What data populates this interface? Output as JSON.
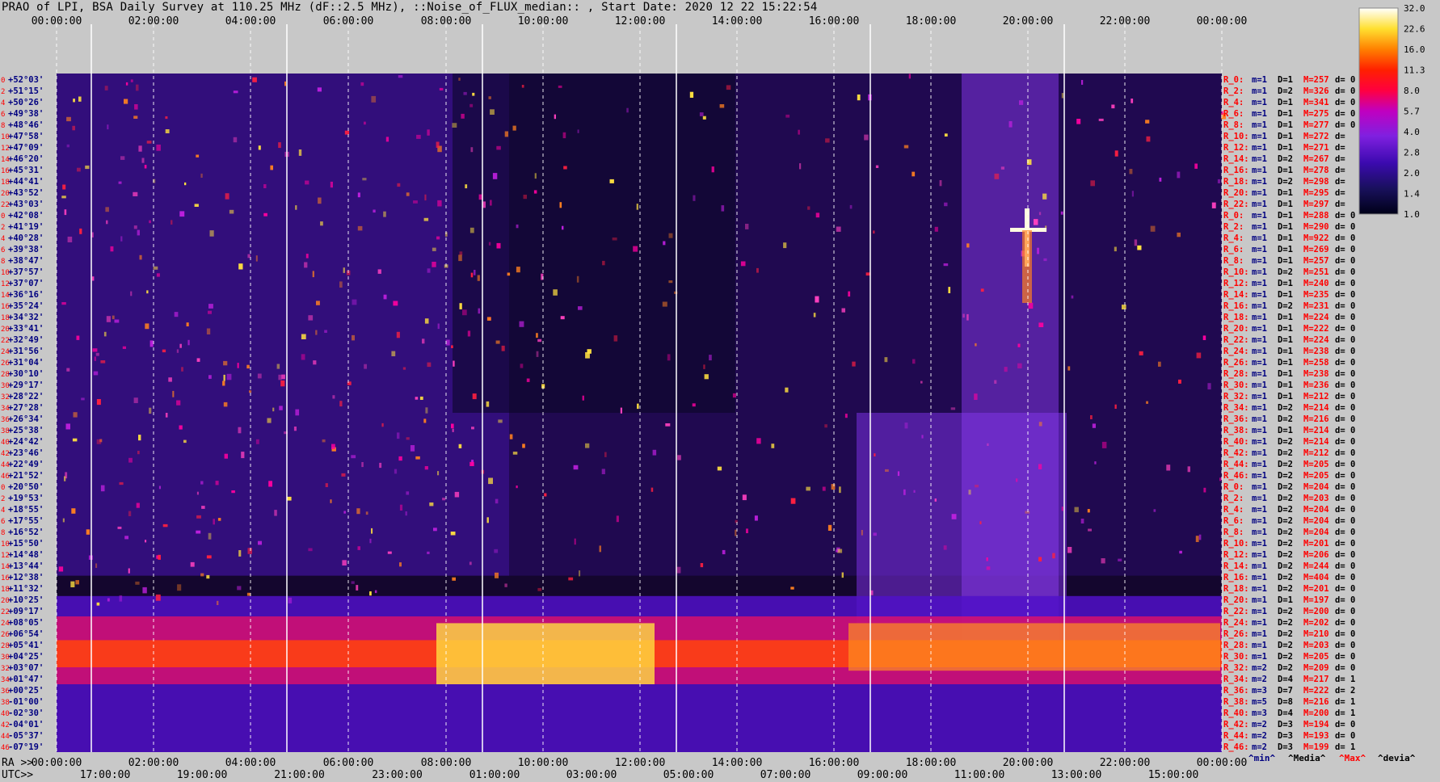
{
  "chart_data": {
    "type": "heatmap",
    "title": "PRAO of LPI, BSA Daily Survey at 110.25 MHz (dF::2.5 MHz), ::Noise_of_FLUX_median:: , Start Date: 2020 12 22 15:22:54",
    "top_axis_ticks": [
      "00:00:00",
      "02:00:00",
      "04:00:00",
      "06:00:00",
      "08:00:00",
      "10:00:00",
      "12:00:00",
      "14:00:00",
      "16:00:00",
      "18:00:00",
      "20:00:00",
      "22:00:00",
      "00:00:00"
    ],
    "ra_axis_label": "RA >>",
    "ra_axis_ticks": [
      "00:00:00",
      "02:00:00",
      "04:00:00",
      "06:00:00",
      "08:00:00",
      "10:00:00",
      "12:00:00",
      "14:00:00",
      "16:00:00",
      "18:00:00",
      "20:00:00",
      "22:00:00",
      "00:00:00"
    ],
    "utc_axis_label": "UTC>>",
    "utc_axis_ticks": [
      "17:00:00",
      "19:00:00",
      "21:00:00",
      "23:00:00",
      "01:00:00",
      "03:00:00",
      "05:00:00",
      "07:00:00",
      "09:00:00",
      "11:00:00",
      "13:00:00",
      "15:00:00"
    ],
    "declination_labels": [
      "+52°03'",
      "+51°15'",
      "+50°26'",
      "+49°38'",
      "+48°46'",
      "+47°58'",
      "+47°09'",
      "+46°20'",
      "+45°31'",
      "+44°41'",
      "+43°52'",
      "+43°03'",
      "+42°08'",
      "+41°19'",
      "+40°28'",
      "+39°38'",
      "+38°47'",
      "+37°57'",
      "+37°07'",
      "+36°16'",
      "+35°24'",
      "+34°32'",
      "+33°41'",
      "+32°49'",
      "+31°56'",
      "+31°04'",
      "+30°10'",
      "+29°17'",
      "+28°22'",
      "+27°28'",
      "+26°34'",
      "+25°38'",
      "+24°42'",
      "+23°46'",
      "+22°49'",
      "+21°52'",
      "+20°50'",
      "+19°53'",
      "+18°55'",
      "+17°55'",
      "+16°52'",
      "+15°50'",
      "+14°48'",
      "+13°44'",
      "+12°38'",
      "+11°32'",
      "+10°25'",
      "+09°17'",
      "+08°05'",
      "+06°54'",
      "+05°41'",
      "+04°25'",
      "+03°07'",
      "+01°47'",
      "+00°25'",
      "-01°00'",
      "-02°30'",
      "-04°01'",
      "-05°37'",
      "-07°19'"
    ],
    "row_index_labels": [
      "0",
      "2",
      "4",
      "6",
      "8",
      "10",
      "12",
      "14",
      "16",
      "18",
      "20",
      "22",
      "0",
      "2",
      "4",
      "6",
      "8",
      "10",
      "12",
      "14",
      "16",
      "18",
      "20",
      "22",
      "24",
      "26",
      "28",
      "30",
      "32",
      "34",
      "36",
      "38",
      "40",
      "42",
      "44",
      "46",
      "0",
      "2",
      "4",
      "6",
      "8",
      "10",
      "12",
      "14",
      "16",
      "18",
      "20",
      "22",
      "24",
      "26",
      "28",
      "30",
      "32",
      "34",
      "36",
      "38",
      "40",
      "42",
      "44",
      "46"
    ],
    "receiver_stats": [
      {
        "r": "R_0:",
        "m": "m=1",
        "d": "D=1",
        "max": "M=257",
        "dev": "d= 0"
      },
      {
        "r": "R_2:",
        "m": "m=1",
        "d": "D=2",
        "max": "M=326",
        "dev": "d= 0"
      },
      {
        "r": "R_4:",
        "m": "m=1",
        "d": "D=1",
        "max": "M=341",
        "dev": "d= 0"
      },
      {
        "r": "R_6:",
        "m": "m=1",
        "d": "D=1",
        "max": "M=275",
        "dev": "d= 0"
      },
      {
        "r": "R_8:",
        "m": "m=1",
        "d": "D=1",
        "max": "M=277",
        "dev": "d= 0"
      },
      {
        "r": "R_10:",
        "m": "m=1",
        "d": "D=1",
        "max": "M=272",
        "dev": "d="
      },
      {
        "r": "R_12:",
        "m": "m=1",
        "d": "D=1",
        "max": "M=271",
        "dev": "d="
      },
      {
        "r": "R_14:",
        "m": "m=1",
        "d": "D=2",
        "max": "M=267",
        "dev": "d="
      },
      {
        "r": "R_16:",
        "m": "m=1",
        "d": "D=1",
        "max": "M=278",
        "dev": "d="
      },
      {
        "r": "R_18:",
        "m": "m=1",
        "d": "D=2",
        "max": "M=298",
        "dev": "d="
      },
      {
        "r": "R_20:",
        "m": "m=1",
        "d": "D=1",
        "max": "M=295",
        "dev": "d="
      },
      {
        "r": "R_22:",
        "m": "m=1",
        "d": "D=1",
        "max": "M=297",
        "dev": "d="
      },
      {
        "r": "R_0:",
        "m": "m=1",
        "d": "D=1",
        "max": "M=288",
        "dev": "d= 0"
      },
      {
        "r": "R_2:",
        "m": "m=1",
        "d": "D=1",
        "max": "M=290",
        "dev": "d= 0"
      },
      {
        "r": "R_4:",
        "m": "m=1",
        "d": "D=1",
        "max": "M=922",
        "dev": "d= 0"
      },
      {
        "r": "R_6:",
        "m": "m=1",
        "d": "D=1",
        "max": "M=269",
        "dev": "d= 0"
      },
      {
        "r": "R_8:",
        "m": "m=1",
        "d": "D=1",
        "max": "M=257",
        "dev": "d= 0"
      },
      {
        "r": "R_10:",
        "m": "m=1",
        "d": "D=2",
        "max": "M=251",
        "dev": "d= 0"
      },
      {
        "r": "R_12:",
        "m": "m=1",
        "d": "D=1",
        "max": "M=240",
        "dev": "d= 0"
      },
      {
        "r": "R_14:",
        "m": "m=1",
        "d": "D=1",
        "max": "M=235",
        "dev": "d= 0"
      },
      {
        "r": "R_16:",
        "m": "m=1",
        "d": "D=2",
        "max": "M=231",
        "dev": "d= 0"
      },
      {
        "r": "R_18:",
        "m": "m=1",
        "d": "D=1",
        "max": "M=224",
        "dev": "d= 0"
      },
      {
        "r": "R_20:",
        "m": "m=1",
        "d": "D=1",
        "max": "M=222",
        "dev": "d= 0"
      },
      {
        "r": "R_22:",
        "m": "m=1",
        "d": "D=1",
        "max": "M=224",
        "dev": "d= 0"
      },
      {
        "r": "R_24:",
        "m": "m=1",
        "d": "D=1",
        "max": "M=238",
        "dev": "d= 0"
      },
      {
        "r": "R_26:",
        "m": "m=1",
        "d": "D=1",
        "max": "M=258",
        "dev": "d= 0"
      },
      {
        "r": "R_28:",
        "m": "m=1",
        "d": "D=1",
        "max": "M=238",
        "dev": "d= 0"
      },
      {
        "r": "R_30:",
        "m": "m=1",
        "d": "D=1",
        "max": "M=236",
        "dev": "d= 0"
      },
      {
        "r": "R_32:",
        "m": "m=1",
        "d": "D=1",
        "max": "M=212",
        "dev": "d= 0"
      },
      {
        "r": "R_34:",
        "m": "m=1",
        "d": "D=2",
        "max": "M=214",
        "dev": "d= 0"
      },
      {
        "r": "R_36:",
        "m": "m=1",
        "d": "D=2",
        "max": "M=216",
        "dev": "d= 0"
      },
      {
        "r": "R_38:",
        "m": "m=1",
        "d": "D=1",
        "max": "M=214",
        "dev": "d= 0"
      },
      {
        "r": "R_40:",
        "m": "m=1",
        "d": "D=2",
        "max": "M=214",
        "dev": "d= 0"
      },
      {
        "r": "R_42:",
        "m": "m=1",
        "d": "D=2",
        "max": "M=212",
        "dev": "d= 0"
      },
      {
        "r": "R_44:",
        "m": "m=1",
        "d": "D=2",
        "max": "M=205",
        "dev": "d= 0"
      },
      {
        "r": "R_46:",
        "m": "m=1",
        "d": "D=2",
        "max": "M=205",
        "dev": "d= 0"
      },
      {
        "r": "R_0:",
        "m": "m=1",
        "d": "D=2",
        "max": "M=204",
        "dev": "d= 0"
      },
      {
        "r": "R_2:",
        "m": "m=1",
        "d": "D=2",
        "max": "M=203",
        "dev": "d= 0"
      },
      {
        "r": "R_4:",
        "m": "m=1",
        "d": "D=2",
        "max": "M=204",
        "dev": "d= 0"
      },
      {
        "r": "R_6:",
        "m": "m=1",
        "d": "D=2",
        "max": "M=204",
        "dev": "d= 0"
      },
      {
        "r": "R_8:",
        "m": "m=1",
        "d": "D=2",
        "max": "M=204",
        "dev": "d= 0"
      },
      {
        "r": "R_10:",
        "m": "m=1",
        "d": "D=2",
        "max": "M=201",
        "dev": "d= 0"
      },
      {
        "r": "R_12:",
        "m": "m=1",
        "d": "D=2",
        "max": "M=206",
        "dev": "d= 0"
      },
      {
        "r": "R_14:",
        "m": "m=1",
        "d": "D=2",
        "max": "M=244",
        "dev": "d= 0"
      },
      {
        "r": "R_16:",
        "m": "m=1",
        "d": "D=2",
        "max": "M=404",
        "dev": "d= 0"
      },
      {
        "r": "R_18:",
        "m": "m=1",
        "d": "D=2",
        "max": "M=201",
        "dev": "d= 0"
      },
      {
        "r": "R_20:",
        "m": "m=1",
        "d": "D=1",
        "max": "M=197",
        "dev": "d= 0"
      },
      {
        "r": "R_22:",
        "m": "m=1",
        "d": "D=2",
        "max": "M=200",
        "dev": "d= 0"
      },
      {
        "r": "R_24:",
        "m": "m=1",
        "d": "D=2",
        "max": "M=202",
        "dev": "d= 0"
      },
      {
        "r": "R_26:",
        "m": "m=1",
        "d": "D=2",
        "max": "M=210",
        "dev": "d= 0"
      },
      {
        "r": "R_28:",
        "m": "m=1",
        "d": "D=2",
        "max": "M=203",
        "dev": "d= 0"
      },
      {
        "r": "R_30:",
        "m": "m=1",
        "d": "D=2",
        "max": "M=205",
        "dev": "d= 0"
      },
      {
        "r": "R_32:",
        "m": "m=2",
        "d": "D=2",
        "max": "M=209",
        "dev": "d= 0"
      },
      {
        "r": "R_34:",
        "m": "m=2",
        "d": "D=4",
        "max": "M=217",
        "dev": "d= 1"
      },
      {
        "r": "R_36:",
        "m": "m=3",
        "d": "D=7",
        "max": "M=222",
        "dev": "d= 2"
      },
      {
        "r": "R_38:",
        "m": "m=5",
        "d": "D=8",
        "max": "M=216",
        "dev": "d= 1"
      },
      {
        "r": "R_40:",
        "m": "m=3",
        "d": "D=4",
        "max": "M=200",
        "dev": "d= 1"
      },
      {
        "r": "R_42:",
        "m": "m=2",
        "d": "D=3",
        "max": "M=194",
        "dev": "d= 0"
      },
      {
        "r": "R_44:",
        "m": "m=2",
        "d": "D=3",
        "max": "M=193",
        "dev": "d= 0"
      },
      {
        "r": "R_46:",
        "m": "m=2",
        "d": "D=3",
        "max": "M=199",
        "dev": "d= 1"
      }
    ],
    "stats_legend": {
      "min": "^min^",
      "median": "^Media^",
      "max": "^Max^",
      "dev": "^devia^"
    },
    "colorbar": {
      "labels": [
        "32.0",
        "22.6",
        "16.0",
        "11.3",
        "8.0",
        "5.7",
        "4.0",
        "2.8",
        "2.0",
        "1.4",
        "1.0"
      ],
      "range": [
        1.0,
        32.0
      ],
      "scale": "log"
    },
    "colors": {
      "text_dark": "#000000",
      "text_red": "#ff0000",
      "text_blue": "#000080",
      "background": "#c8c8c8"
    }
  }
}
